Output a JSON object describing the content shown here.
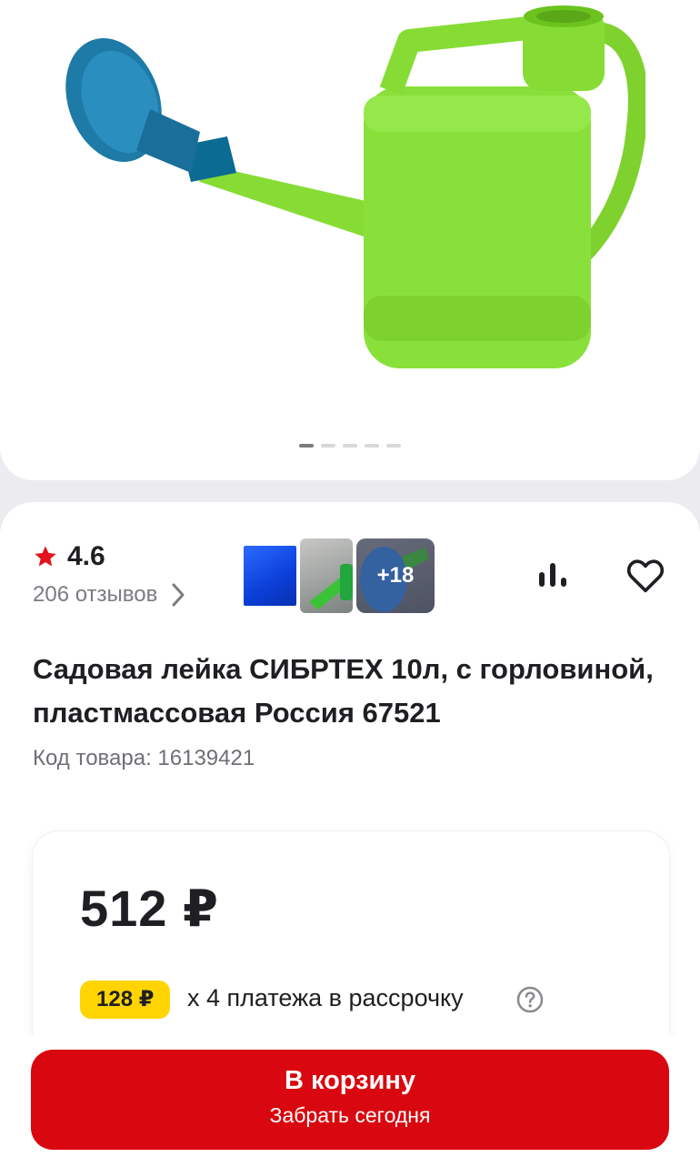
{
  "gallery": {
    "image_alt": "Садовая лейка",
    "dots_total": 5,
    "dots_active": 0
  },
  "rating": {
    "value": "4.6",
    "reviews": "206 отзывов",
    "star_color": "#e3121b"
  },
  "thumbnails": {
    "more_count": "+18"
  },
  "product": {
    "title": "Садовая лейка СИБРТЕХ 10л, с горловиной, пластмассовая Россия 67521",
    "sku": "Код товара: 16139421"
  },
  "price": {
    "value": "512 ₽",
    "installment_amount": "128 ₽",
    "installment_text": "х 4 платежа в рассрочку"
  },
  "cart": {
    "label": "В корзину",
    "sublabel": "Забрать сегодня",
    "color": "#d9070f"
  },
  "icons": {
    "compare": "compare-icon",
    "favorite": "heart-icon",
    "help": "question-icon",
    "chevron": "chevron-right-icon",
    "star": "star-icon"
  }
}
